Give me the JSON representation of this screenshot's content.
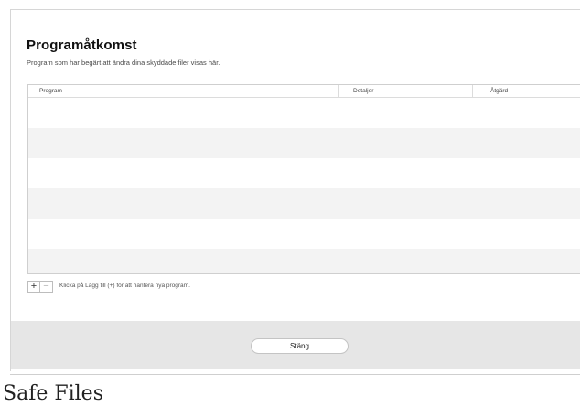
{
  "dialog": {
    "title": "Programåtkomst",
    "subtitle": "Program som har begärt att ändra dina skyddade filer visas här.",
    "table": {
      "columns": [
        "Program",
        "Detaljer",
        "Åtgärd"
      ],
      "rows": []
    },
    "add_label": "+",
    "remove_label": "−",
    "hint": "Klicka på Lägg till (+) för att hantera nya program.",
    "close_label": "Stäng"
  },
  "caption": "Safe Files",
  "colors": {
    "footer_bg": "#e6e6e6",
    "row_alt": "#f3f3f3"
  }
}
